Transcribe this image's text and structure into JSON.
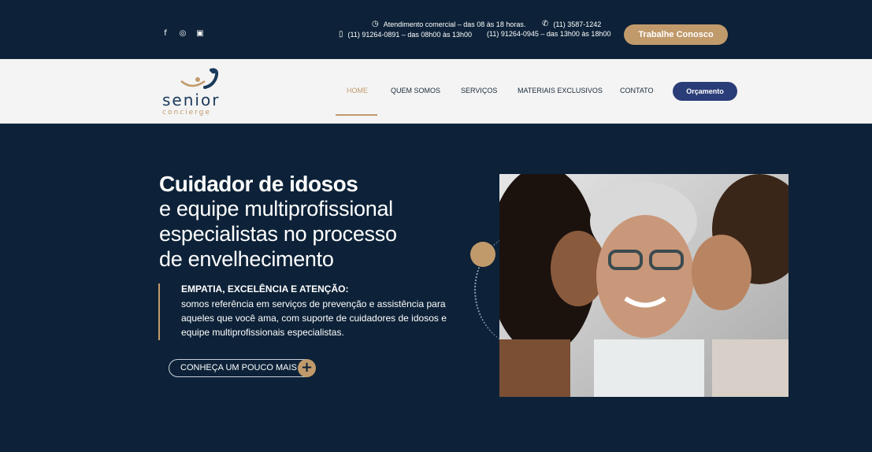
{
  "colors": {
    "navy": "#0d2238",
    "gold": "#c19a6b",
    "button_blue": "#2a3d78"
  },
  "topbar": {
    "social": [
      {
        "icon": "facebook-icon",
        "glyph": "f"
      },
      {
        "icon": "instagram-icon",
        "glyph": "◎"
      },
      {
        "icon": "linkedin-icon",
        "glyph": "▣"
      }
    ],
    "hours": "Atendimento comercial – das 08 às 18 horas.",
    "phone_main": "(11) 3587-1242",
    "mobile1": "(11) 91264-0891 – das 08h00 às 13h00",
    "mobile2": "(11) 91264-0945 – das 13h00 às 18h00",
    "work_button": "Trabalhe Conosco"
  },
  "nav": {
    "logo_word1": "senior",
    "logo_word2": "concierge",
    "items": [
      "HOME",
      "QUEM SOMOS",
      "SERVIÇOS",
      "MATERIAIS EXCLUSIVOS",
      "CONTATO"
    ],
    "cta": "Orçamento"
  },
  "hero": {
    "title": "Cuidador de idosos",
    "line1": "e equipe multiprofissional",
    "line2": "especialistas no processo",
    "line3": "de envelhecimento",
    "subhead": "EMPATIA, EXCELÊNCIA E ATENÇÃO:",
    "body": "somos referência em serviços de prevenção e assistência para aqueles que você ama, com suporte de cuidadores de idosos e equipe multiprofissionais especialistas.",
    "button": "CONHEÇA UM POUCO MAIS"
  }
}
